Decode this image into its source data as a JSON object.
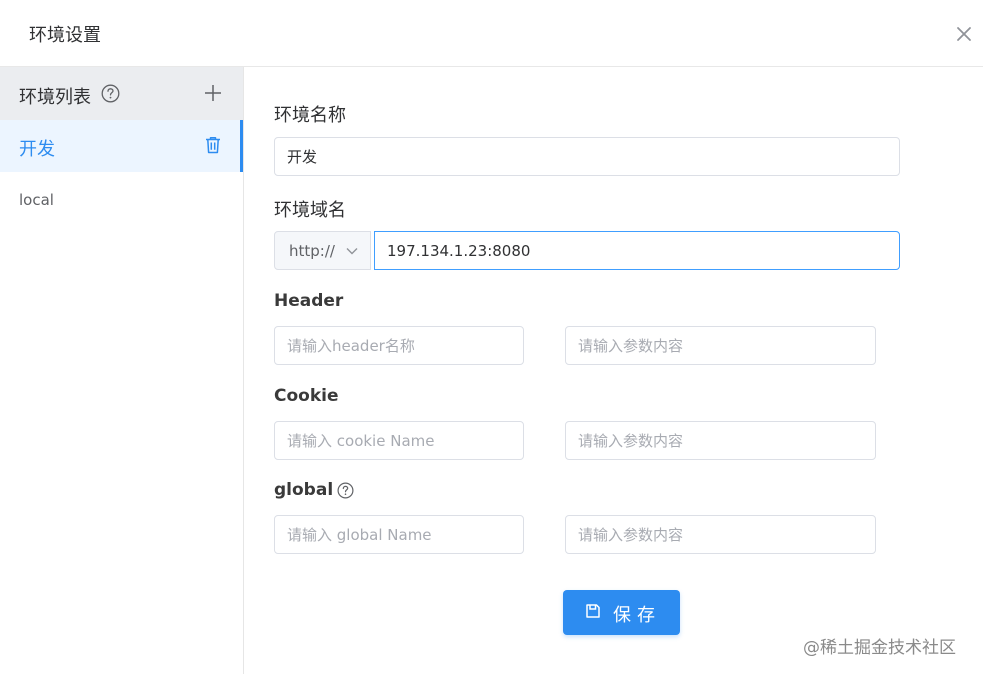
{
  "dialog": {
    "title": "环境设置"
  },
  "sidebar": {
    "header_label": "环境列表",
    "items": [
      {
        "label": "开发",
        "active": true
      },
      {
        "label": "local",
        "active": false
      }
    ]
  },
  "form": {
    "env_name": {
      "label": "环境名称",
      "value": "开发"
    },
    "env_domain": {
      "label": "环境域名",
      "protocol": "http://",
      "value": "197.134.1.23:8080"
    },
    "header": {
      "label": "Header",
      "name_placeholder": "请输入header名称",
      "value_placeholder": "请输入参数内容"
    },
    "cookie": {
      "label": "Cookie",
      "name_placeholder": "请输入 cookie Name",
      "value_placeholder": "请输入参数内容"
    },
    "global": {
      "label": "global",
      "name_placeholder": "请输入 global Name",
      "value_placeholder": "请输入参数内容"
    },
    "save_label": "保存"
  },
  "watermark": "@稀土掘金技术社区",
  "colors": {
    "accent": "#2d8cf0",
    "active_bg": "#ecf5ff",
    "sidebar_header_bg": "#ebedf0"
  }
}
